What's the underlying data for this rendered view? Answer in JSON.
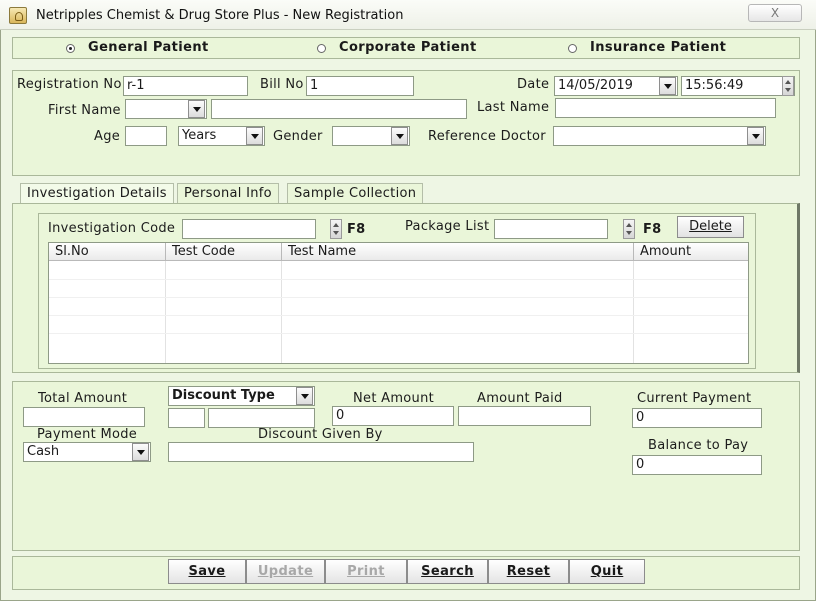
{
  "window": {
    "title": "Netripples Chemist & Drug Store Plus - New Registration",
    "close_label": "X"
  },
  "patient_type": {
    "options": [
      "General Patient",
      "Corporate Patient",
      "Insurance Patient"
    ],
    "selected": "General Patient"
  },
  "registration": {
    "reg_no_label": "Registration No",
    "reg_no_value": "r-1",
    "bill_no_label": "Bill No",
    "bill_no_value": "1",
    "date_label": "Date",
    "date_value": "14/05/2019",
    "time_value": "15:56:49",
    "first_name_label": "First Name",
    "first_name_title_value": "",
    "first_name_value": "",
    "last_name_label": "Last Name",
    "last_name_value": "",
    "age_label": "Age",
    "age_value": "",
    "age_unit_value": "Years",
    "gender_label": "Gender",
    "gender_value": "",
    "ref_doctor_label": "Reference Doctor",
    "ref_doctor_value": ""
  },
  "tabs": [
    {
      "label": "Investigation Details",
      "active": true
    },
    {
      "label": "Personal Info",
      "active": false
    },
    {
      "label": "Sample Collection",
      "active": false
    }
  ],
  "investigation": {
    "code_label": "Investigation Code",
    "code_value": "",
    "code_shortcut": "F8",
    "package_label": "Package List",
    "package_value": "",
    "package_shortcut": "F8",
    "delete_label": "Delete",
    "columns": [
      "Sl.No",
      "Test Code",
      "Test Name",
      "Amount"
    ],
    "rows": []
  },
  "billing": {
    "total_amount_label": "Total Amount",
    "total_amount_value": "",
    "discount_type_label": "Discount Type",
    "discount_value_1": "",
    "discount_value_2": "",
    "net_amount_label": "Net Amount",
    "net_amount_value": "0",
    "amount_paid_label": "Amount Paid",
    "amount_paid_value": "",
    "current_payment_label": "Current Payment",
    "current_payment_value": "0",
    "payment_mode_label": "Payment Mode",
    "payment_mode_value": "Cash",
    "discount_by_label": "Discount Given By",
    "discount_by_value": "",
    "balance_label": "Balance to Pay",
    "balance_value": "0"
  },
  "actions": {
    "save": "Save",
    "update": "Update",
    "print": "Print",
    "search": "Search",
    "reset": "Reset",
    "quit": "Quit"
  }
}
